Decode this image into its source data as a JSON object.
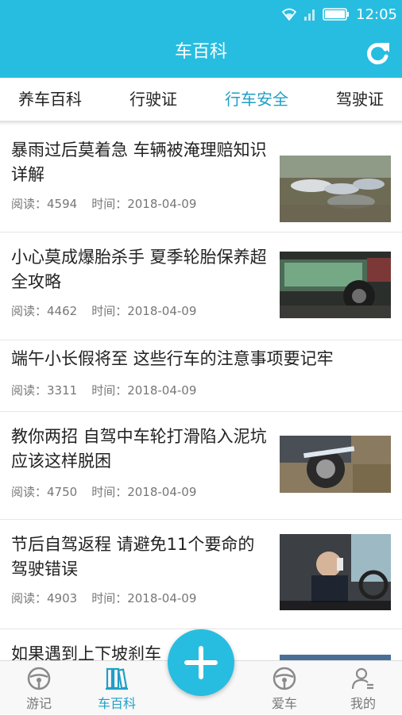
{
  "status": {
    "time": "12:05"
  },
  "header": {
    "title": "车百科"
  },
  "tabs": [
    {
      "label": "养车百科",
      "active": false
    },
    {
      "label": "行驶证",
      "active": false
    },
    {
      "label": "行车安全",
      "active": true
    },
    {
      "label": "驾驶证",
      "active": false
    }
  ],
  "articles": [
    {
      "title": "暴雨过后莫着急 车辆被淹理赔知识详解",
      "reads_label": "阅读：4594",
      "time_label": "时间：2018-04-09"
    },
    {
      "title": "小心莫成爆胎杀手 夏季轮胎保养超全攻略",
      "reads_label": "阅读：4462",
      "time_label": "时间：2018-04-09"
    },
    {
      "title": "端午小长假将至 这些行车的注意事项要记牢",
      "reads_label": "阅读：3311",
      "time_label": "时间：2018-04-09"
    },
    {
      "title": "教你两招 自驾中车轮打滑陷入泥坑应该这样脱困",
      "reads_label": "阅读：4750",
      "time_label": "时间：2018-04-09"
    },
    {
      "title": "节后自驾返程 请避免11个要命的驾驶错误",
      "reads_label": "阅读：4903",
      "time_label": "时间：2018-04-09"
    },
    {
      "title": "如果遇到上下坡刹车",
      "reads_label": "",
      "time_label": ""
    }
  ],
  "tabbar": [
    {
      "label": "游记",
      "icon": "steering-wheel-icon",
      "active": false
    },
    {
      "label": "车百科",
      "icon": "books-icon",
      "active": true
    },
    {
      "label": "爱车",
      "icon": "steering-wheel-icon",
      "active": false
    },
    {
      "label": "我的",
      "icon": "user-icon",
      "active": false
    }
  ],
  "colors": {
    "brand": "#27bde0",
    "active_tab": "#1f9fc7"
  }
}
